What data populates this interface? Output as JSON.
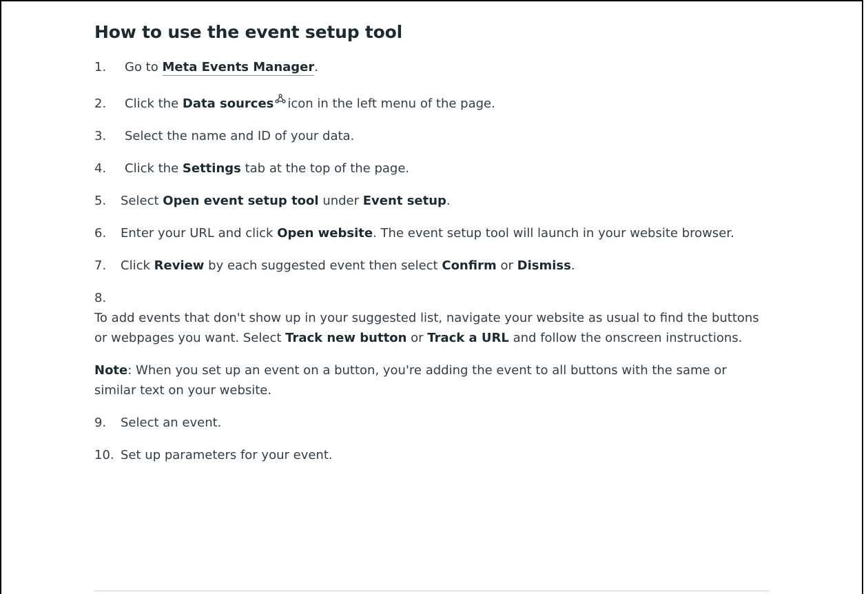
{
  "heading": "How to use the event setup tool",
  "steps": {
    "s1": {
      "num": "1.",
      "pre": "Go to",
      "link": "Meta Events Manager",
      "post": "."
    },
    "s2": {
      "num": "2.",
      "pre": "Click the",
      "bold": "Data sources",
      "post": "icon in the left menu of the page.",
      "icon": "data-sources-icon"
    },
    "s3": {
      "num": "3.",
      "text": "Select the name and ID of your data."
    },
    "s4": {
      "num": "4.",
      "pre": "Click the",
      "bold": "Settings",
      "post": "tab at the top of the page."
    },
    "s5": {
      "num": "5.",
      "pre": "Select",
      "bold1": "Open event setup tool",
      "mid": "under",
      "bold2": "Event setup",
      "post": "."
    },
    "s6": {
      "num": "6.",
      "pre": "Enter your URL and click",
      "bold": "Open website",
      "post": ". The event setup tool will launch in your website browser."
    },
    "s7": {
      "num": "7.",
      "pre": "Click",
      "bold1": "Review",
      "mid": "by each suggested event then select",
      "bold2": "Confirm",
      "mid2": "or",
      "bold3": "Dismiss",
      "post": "."
    },
    "s8": {
      "num": "8.",
      "pre": "To add events that don't show up in your suggested list, navigate your website as usual to find the buttons or webpages you want. Select",
      "bold1": "Track new button",
      "mid": "or",
      "bold2": "Track a URL",
      "post": "and follow the onscreen instructions."
    },
    "note": {
      "label": "Note",
      "text": ": When you set up an event on a button, you're adding the event to all buttons with the same or similar text on your website."
    },
    "s9": {
      "num": "9.",
      "text": "Select an event."
    },
    "s10": {
      "num": "10.",
      "text": "Set up parameters for your event."
    }
  }
}
